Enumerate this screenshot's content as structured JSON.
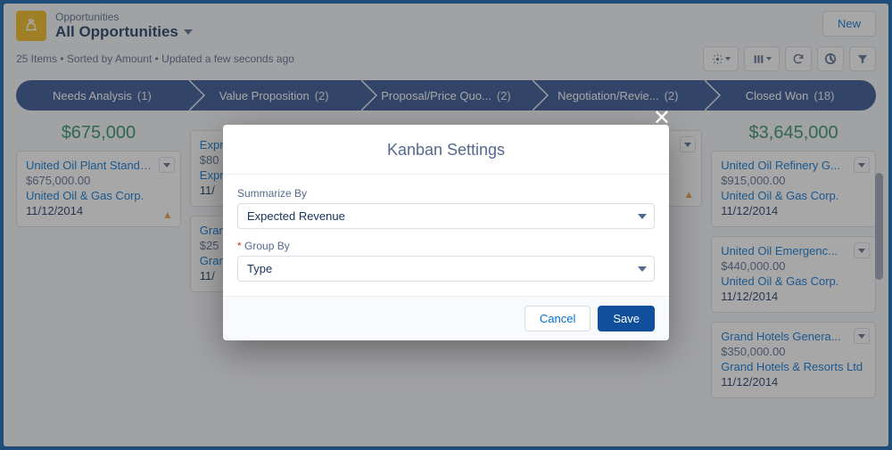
{
  "header": {
    "object_label": "Opportunities",
    "view_name": "All Opportunities",
    "new_label": "New",
    "meta_text": "25 Items • Sorted by Amount • Updated a few seconds ago",
    "toolbar_icons": [
      "gear",
      "grid",
      "refresh",
      "chart",
      "filter"
    ]
  },
  "stages": [
    {
      "name": "Needs Analysis",
      "count": "(1)",
      "total": "$675,000"
    },
    {
      "name": "Value Proposition",
      "count": "(2)",
      "total": ""
    },
    {
      "name": "Proposal/Price Quo...",
      "count": "(2)",
      "total": ""
    },
    {
      "name": "Negotiation/Revie...",
      "count": "(2)",
      "total": ""
    },
    {
      "name": "Closed Won",
      "count": "(18)",
      "total": "$3,645,000"
    }
  ],
  "columns": {
    "col0": [
      {
        "title": "United Oil Plant Standby...",
        "amount": "$675,000.00",
        "account": "United Oil & Gas Corp.",
        "date": "11/12/2014",
        "warn": true
      }
    ],
    "col1": [
      {
        "title": "Expr",
        "amount": "$80",
        "account": "Expr",
        "date": "11/",
        "warn": true
      },
      {
        "title": "Gran",
        "amount": "$25",
        "account": "Gran",
        "date": "11/",
        "warn": true
      }
    ],
    "col2": [
      {
        "title": "",
        "amount": "",
        "account": "",
        "date": "",
        "warn": true
      }
    ],
    "col3": [
      {
        "title": "",
        "amount": "",
        "account": "",
        "date": "",
        "warn": true
      }
    ],
    "col4": [
      {
        "title": "United Oil Refinery G...",
        "amount": "$915,000.00",
        "account": "United Oil & Gas Corp.",
        "date": "11/12/2014",
        "warn": false
      },
      {
        "title": "United Oil Emergenc...",
        "amount": "$440,000.00",
        "account": "United Oil & Gas Corp.",
        "date": "11/12/2014",
        "warn": false
      },
      {
        "title": "Grand Hotels Genera...",
        "amount": "$350,000.00",
        "account": "Grand Hotels & Resorts Ltd",
        "date": "11/12/2014",
        "warn": false
      }
    ]
  },
  "modal": {
    "title": "Kanban Settings",
    "summarize_label": "Summarize By",
    "summarize_value": "Expected Revenue",
    "group_label": "Group By",
    "group_value": "Type",
    "cancel_label": "Cancel",
    "save_label": "Save"
  }
}
